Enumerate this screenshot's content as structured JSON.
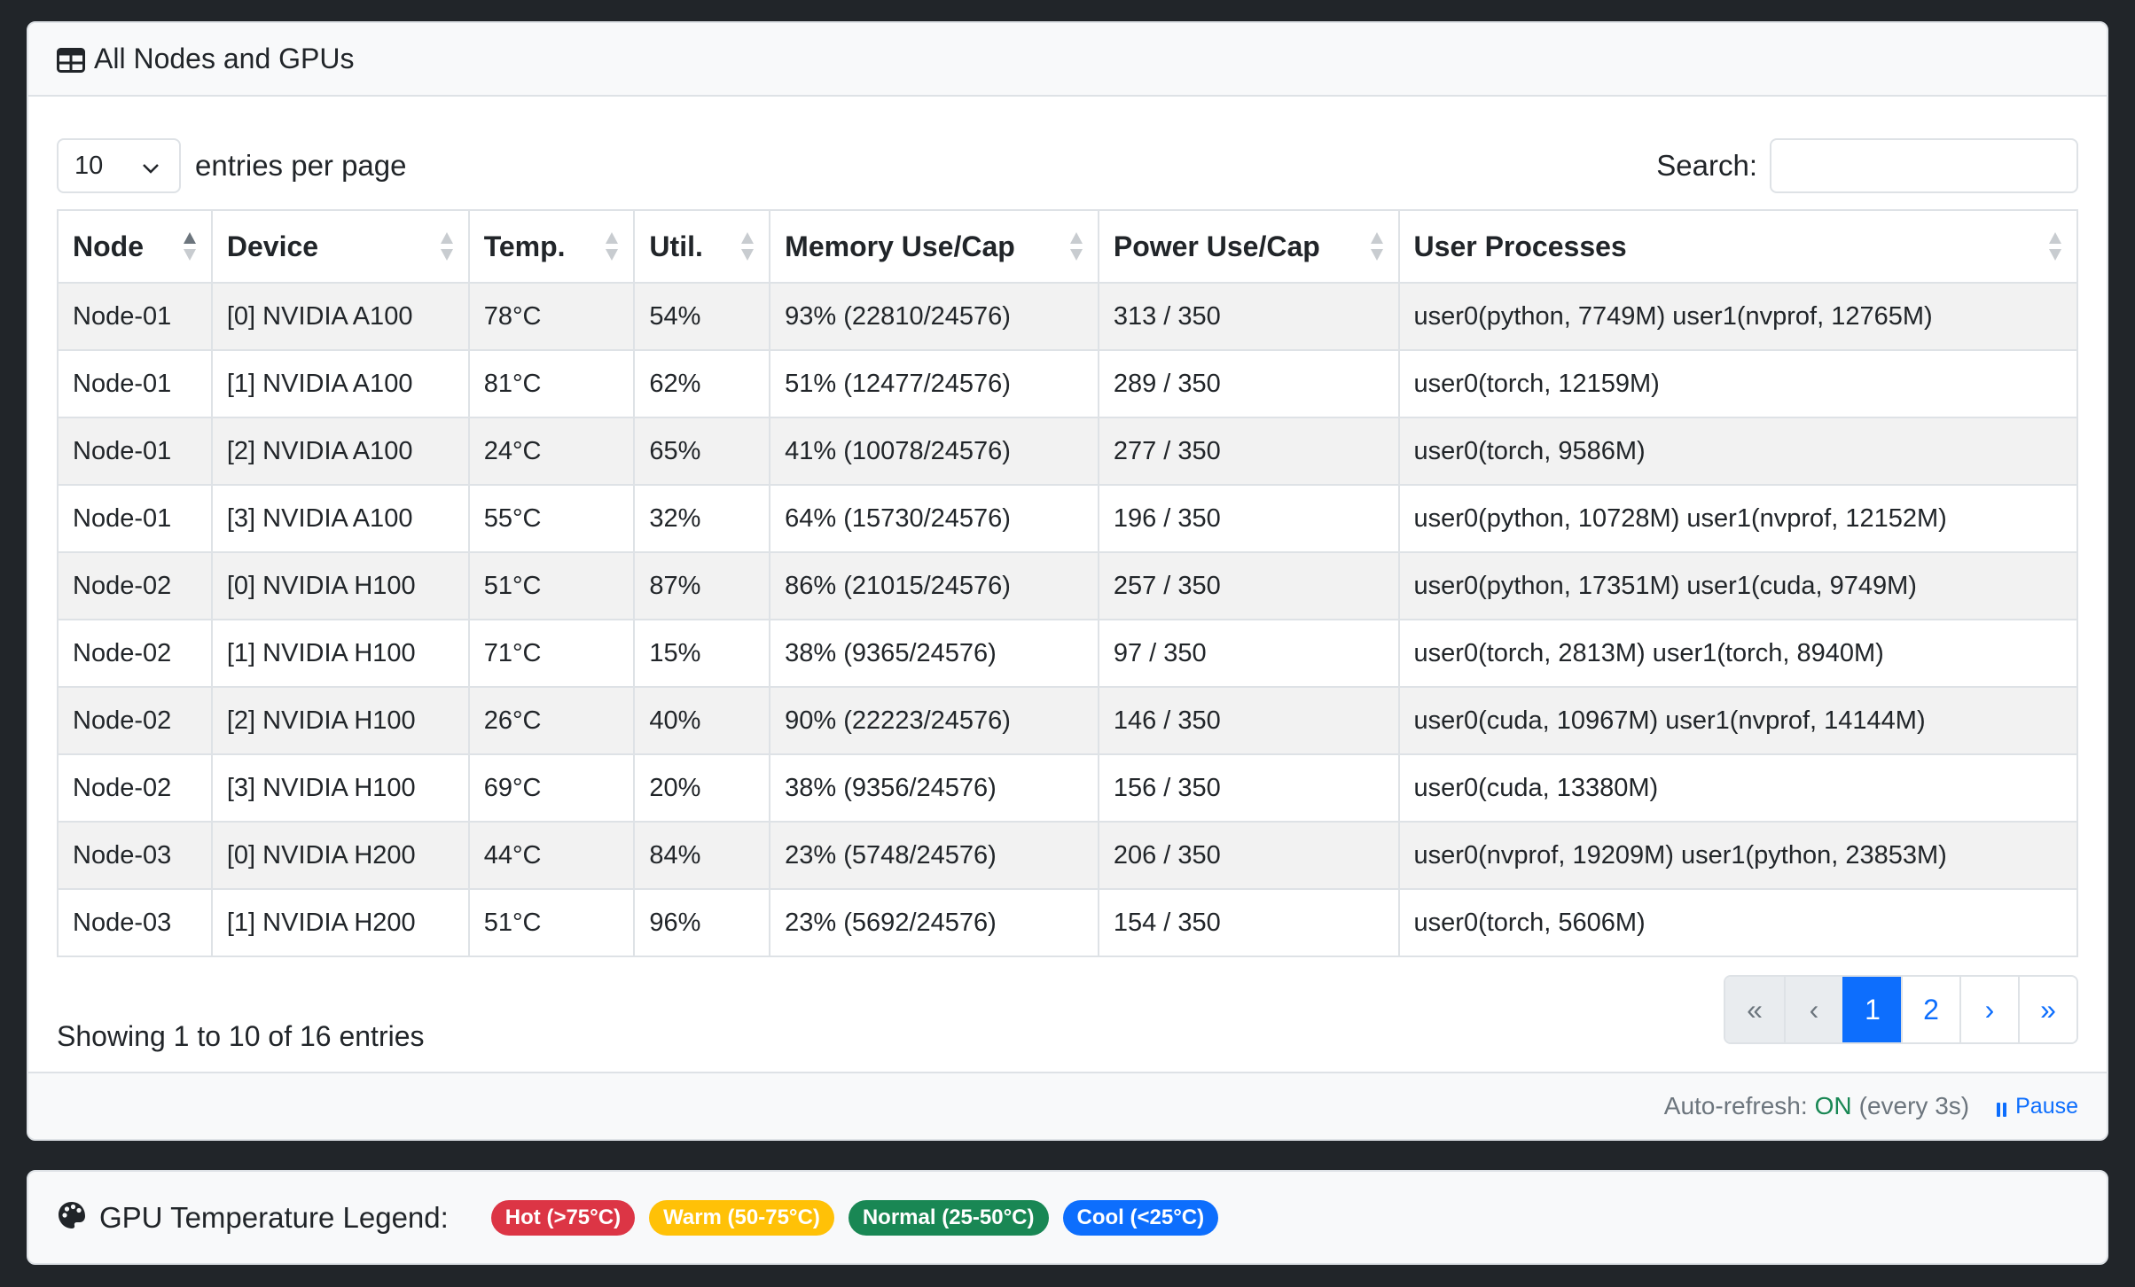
{
  "header": {
    "title": "All Nodes and GPUs",
    "icon": "table-icon"
  },
  "controls": {
    "page_size": "10",
    "page_size_label": "entries per page",
    "search_label": "Search:",
    "search_value": ""
  },
  "table": {
    "columns": [
      "Node",
      "Device",
      "Temp.",
      "Util.",
      "Memory Use/Cap",
      "Power Use/Cap",
      "User Processes"
    ],
    "rows": [
      [
        "Node-01",
        "[0] NVIDIA A100",
        "78°C",
        "54%",
        "93% (22810/24576)",
        "313 / 350",
        "user0(python, 7749M) user1(nvprof, 12765M)"
      ],
      [
        "Node-01",
        "[1] NVIDIA A100",
        "81°C",
        "62%",
        "51% (12477/24576)",
        "289 / 350",
        "user0(torch, 12159M)"
      ],
      [
        "Node-01",
        "[2] NVIDIA A100",
        "24°C",
        "65%",
        "41% (10078/24576)",
        "277 / 350",
        "user0(torch, 9586M)"
      ],
      [
        "Node-01",
        "[3] NVIDIA A100",
        "55°C",
        "32%",
        "64% (15730/24576)",
        "196 / 350",
        "user0(python, 10728M) user1(nvprof, 12152M)"
      ],
      [
        "Node-02",
        "[0] NVIDIA H100",
        "51°C",
        "87%",
        "86% (21015/24576)",
        "257 / 350",
        "user0(python, 17351M) user1(cuda, 9749M)"
      ],
      [
        "Node-02",
        "[1] NVIDIA H100",
        "71°C",
        "15%",
        "38% (9365/24576)",
        "97 / 350",
        "user0(torch, 2813M) user1(torch, 8940M)"
      ],
      [
        "Node-02",
        "[2] NVIDIA H100",
        "26°C",
        "40%",
        "90% (22223/24576)",
        "146 / 350",
        "user0(cuda, 10967M) user1(nvprof, 14144M)"
      ],
      [
        "Node-02",
        "[3] NVIDIA H100",
        "69°C",
        "20%",
        "38% (9356/24576)",
        "156 / 350",
        "user0(cuda, 13380M)"
      ],
      [
        "Node-03",
        "[0] NVIDIA H200",
        "44°C",
        "84%",
        "23% (5748/24576)",
        "206 / 350",
        "user0(nvprof, 19209M) user1(python, 23853M)"
      ],
      [
        "Node-03",
        "[1] NVIDIA H200",
        "51°C",
        "96%",
        "23% (5692/24576)",
        "154 / 350",
        "user0(torch, 5606M)"
      ]
    ]
  },
  "pagination": {
    "info": "Showing 1 to 10 of 16 entries",
    "buttons": [
      {
        "label": "«",
        "state": "disabled",
        "name": "first-page-button"
      },
      {
        "label": "‹",
        "state": "disabled",
        "name": "prev-page-button"
      },
      {
        "label": "1",
        "state": "active",
        "name": "page-1-button"
      },
      {
        "label": "2",
        "state": "normal",
        "name": "page-2-button"
      },
      {
        "label": "›",
        "state": "normal",
        "name": "next-page-button"
      },
      {
        "label": "»",
        "state": "normal",
        "name": "last-page-button"
      }
    ]
  },
  "footer": {
    "refresh_label": "Auto-refresh:",
    "refresh_status": "ON",
    "refresh_interval": "(every 3s)",
    "pause_label": "Pause"
  },
  "legend": {
    "title": "GPU Temperature Legend:",
    "items": [
      {
        "label": "Hot (>75°C)",
        "bg": "#dc3545",
        "fg": "#ffffff"
      },
      {
        "label": "Warm (50-75°C)",
        "bg": "#ffc107",
        "fg": "#ffffff"
      },
      {
        "label": "Normal (25-50°C)",
        "bg": "#198754",
        "fg": "#ffffff"
      },
      {
        "label": "Cool (<25°C)",
        "bg": "#0d6efd",
        "fg": "#ffffff"
      }
    ]
  },
  "colors": {
    "accent": "#0d6efd",
    "success": "#198754"
  }
}
